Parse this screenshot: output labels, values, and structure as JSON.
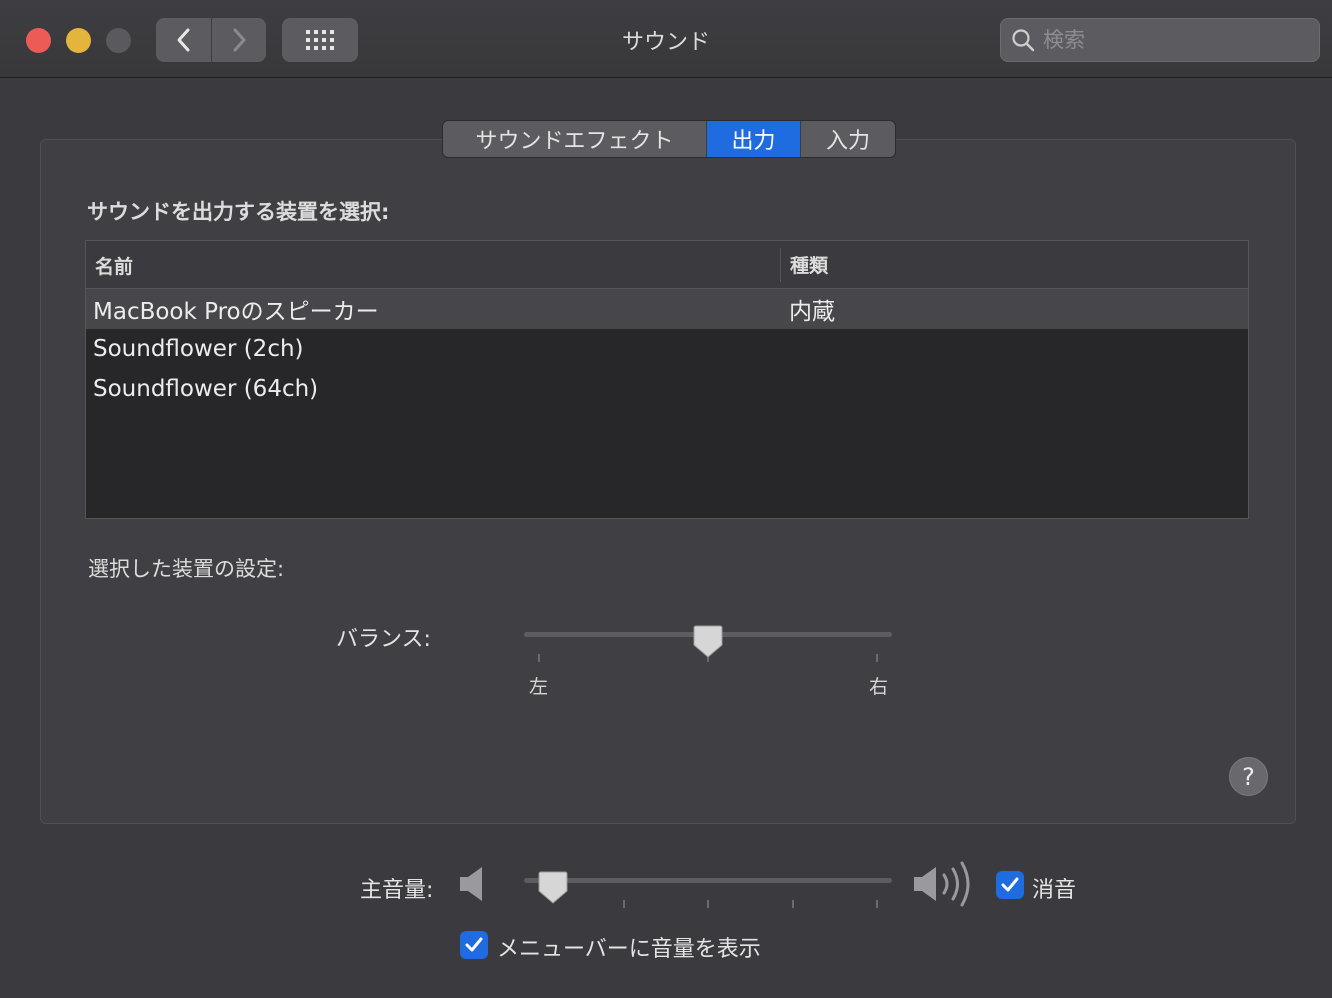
{
  "window": {
    "title": "サウンド"
  },
  "toolbar": {
    "back_icon": "chevron-left-icon",
    "forward_icon": "chevron-right-icon",
    "grid_icon": "grid-icon",
    "search_placeholder": "検索"
  },
  "tabs": [
    {
      "label": "サウンドエフェクト",
      "selected": false
    },
    {
      "label": "出力",
      "selected": true
    },
    {
      "label": "入力",
      "selected": false
    }
  ],
  "output": {
    "device_select_label": "サウンドを出力する装置を選択:",
    "columns": {
      "name": "名前",
      "type": "種類"
    },
    "devices": [
      {
        "name": "MacBook Proのスピーカー",
        "type": "内蔵",
        "selected": true
      },
      {
        "name": "Soundflower (2ch)",
        "type": "",
        "selected": false
      },
      {
        "name": "Soundflower (64ch)",
        "type": "",
        "selected": false
      }
    ],
    "settings_label": "選択した装置の設定:",
    "balance": {
      "label": "バランス:",
      "left": "左",
      "right": "右",
      "value": 0.5
    }
  },
  "master": {
    "volume_label": "主音量:",
    "volume_value": 0.04,
    "mute_label": "消音",
    "mute_checked": true,
    "show_in_menubar_label": "メニューバーに音量を表示",
    "show_in_menubar_checked": true
  },
  "colors": {
    "accent": "#1f6be0",
    "close": "#ed5b56",
    "minimize": "#e3b53d"
  }
}
